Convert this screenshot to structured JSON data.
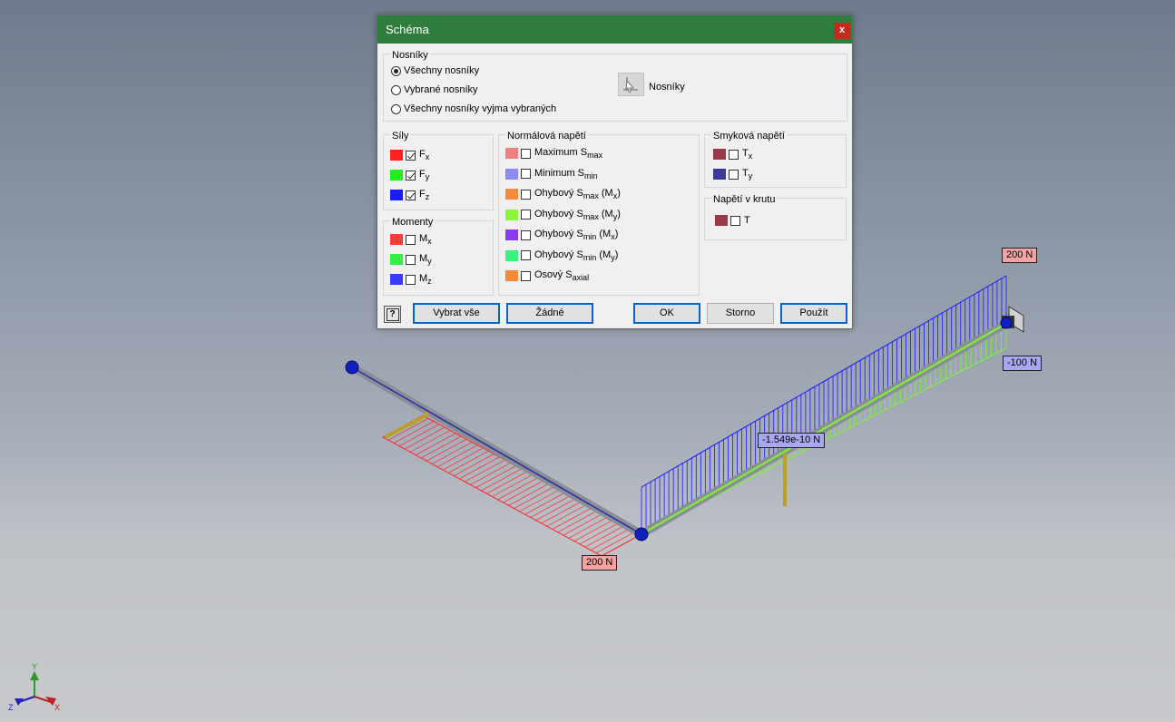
{
  "viewport": {
    "labels": {
      "top_right_force": "200 N",
      "right_negative_force": "-100 N",
      "mid_force": "-1.549e-10 N",
      "bottom_force": "200 N"
    },
    "colors": {
      "beam": "#8a8f96",
      "fx_diagram": "#ff2a2a",
      "fz_diagram": "#1a1aff",
      "fy_diagram": "#7df532",
      "node": "#1020c0",
      "support": "#b8a12a"
    }
  },
  "triad": {
    "x_label": "X",
    "y_label": "Y",
    "z_label": "Z"
  },
  "dialog": {
    "title": "Schéma",
    "close_label": "x",
    "beams_group": {
      "title": "Nosníky",
      "options": [
        "Všechny nosníky",
        "Vybrané nosníky",
        "Všechny nosníky vyjma vybraných"
      ],
      "selected_index": 0,
      "select_label": "Nosníky"
    },
    "forces_group": {
      "title": "Síly",
      "items": [
        {
          "label": "F",
          "sub": "x",
          "color": "#ff2020",
          "checked": true
        },
        {
          "label": "F",
          "sub": "y",
          "color": "#22ee22",
          "checked": true
        },
        {
          "label": "F",
          "sub": "z",
          "color": "#1a1aff",
          "checked": true
        }
      ]
    },
    "moments_group": {
      "title": "Momenty",
      "items": [
        {
          "label": "M",
          "sub": "x",
          "color": "#ff3a3a",
          "checked": false
        },
        {
          "label": "M",
          "sub": "y",
          "color": "#33ee44",
          "checked": false
        },
        {
          "label": "M",
          "sub": "z",
          "color": "#3a3aff",
          "checked": false
        }
      ]
    },
    "normal_group": {
      "title": "Normálová napětí",
      "items": [
        {
          "pre": "Maximum S",
          "sub": "max",
          "post": "",
          "color": "#f08080",
          "checked": false
        },
        {
          "pre": "Minimum S",
          "sub": "min",
          "post": "",
          "color": "#8a8af0",
          "checked": false
        },
        {
          "pre": "Ohybový S",
          "sub": "max",
          "post": " (M",
          "sub2": "x",
          "end": ")",
          "color": "#f58a3a",
          "checked": false
        },
        {
          "pre": "Ohybový S",
          "sub": "max",
          "post": " (M",
          "sub2": "y",
          "end": ")",
          "color": "#8cf53c",
          "checked": false
        },
        {
          "pre": "Ohybový S",
          "sub": "min",
          "post": " (M",
          "sub2": "x",
          "end": ")",
          "color": "#8a3af0",
          "checked": false
        },
        {
          "pre": "Ohybový S",
          "sub": "min",
          "post": " (M",
          "sub2": "y",
          "end": ")",
          "color": "#3af080",
          "checked": false
        },
        {
          "pre": "Osový S",
          "sub": "axial",
          "post": "",
          "color": "#f58a3a",
          "checked": false
        }
      ]
    },
    "shear_group": {
      "title": "Smyková napětí",
      "items": [
        {
          "label": "T",
          "sub": "x",
          "color": "#9a3a48",
          "checked": false
        },
        {
          "label": "T",
          "sub": "y",
          "color": "#3a3a9a",
          "checked": false
        }
      ]
    },
    "torsion_group": {
      "title": "Napětí v krutu",
      "items": [
        {
          "label": "T",
          "sub": "",
          "color": "#9a3a48",
          "checked": false
        }
      ]
    },
    "buttons": {
      "help": "?",
      "select_all": "Vybrat vše",
      "none": "Žádné",
      "ok": "OK",
      "cancel": "Storno",
      "apply": "Použít"
    }
  }
}
